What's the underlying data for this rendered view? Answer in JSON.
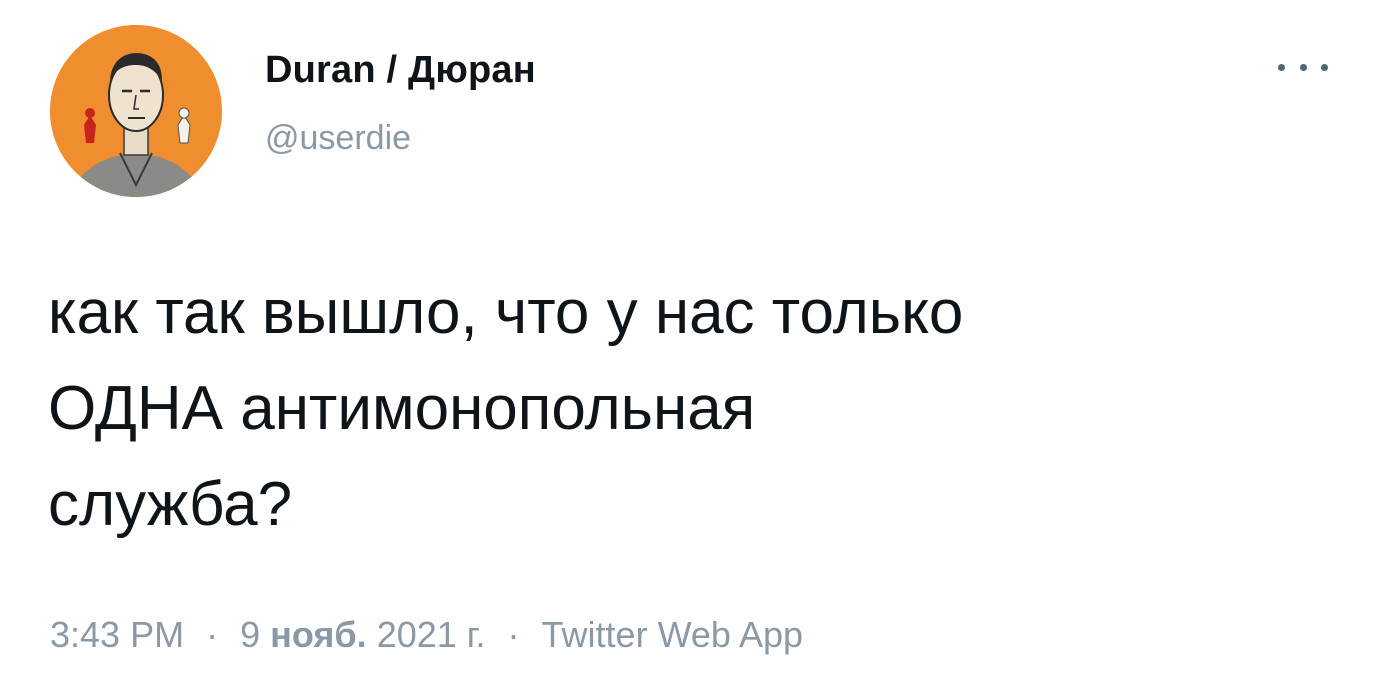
{
  "tweet": {
    "author": {
      "display_name": "Duran / Дюран",
      "handle": "@userdie",
      "avatar_icon": "caricature-avatar-icon",
      "avatar_bg": "#ef8d2f"
    },
    "more_menu_icon": "more-dots-icon",
    "text": "как так вышло, что у нас только\nОДНА антимонопольная\nслужба?",
    "meta": {
      "time": "3:43 PM",
      "separator": "·",
      "date_day": "9",
      "date_month": "нояб.",
      "date_year": "2021 г.",
      "source": "Twitter Web App"
    }
  },
  "colors": {
    "text_primary": "#0f1419",
    "text_secondary": "#8b98a5",
    "background": "#ffffff"
  }
}
